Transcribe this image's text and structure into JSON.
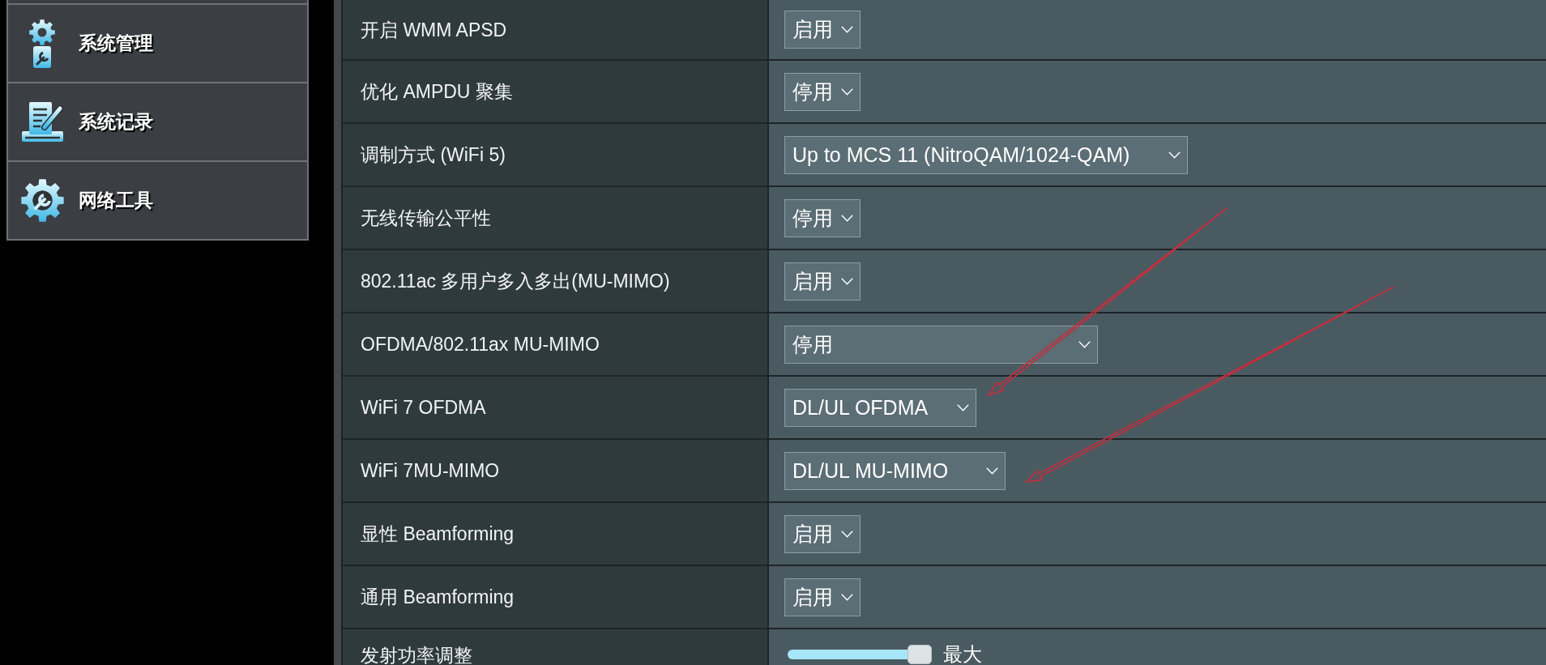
{
  "sidebar": {
    "items": [
      {
        "label": "系统管理",
        "selected": false
      },
      {
        "label": "系统记录",
        "selected": false
      },
      {
        "label": "网络工具",
        "selected": false
      }
    ]
  },
  "settings": {
    "rows": [
      {
        "kind": "select",
        "label": "开启 WMM APSD",
        "value": "启用"
      },
      {
        "kind": "select",
        "label": "优化 AMPDU 聚集",
        "value": "停用"
      },
      {
        "kind": "select",
        "label": "调制方式 (WiFi 5)",
        "value": "Up to MCS 11 (NitroQAM/1024-QAM)"
      },
      {
        "kind": "select",
        "label": "无线传输公平性",
        "value": "停用"
      },
      {
        "kind": "select",
        "label": "802.11ac 多用户多入多出(MU-MIMO)",
        "value": "启用"
      },
      {
        "kind": "select",
        "label": "OFDMA/802.11ax MU-MIMO",
        "value": "停用"
      },
      {
        "kind": "select",
        "label": "WiFi 7 OFDMA",
        "value": "DL/UL OFDMA"
      },
      {
        "kind": "select",
        "label": "WiFi 7MU-MIMO",
        "value": "DL/UL MU-MIMO"
      },
      {
        "kind": "select",
        "label": "显性 Beamforming",
        "value": "启用"
      },
      {
        "kind": "select",
        "label": "通用 Beamforming",
        "value": "启用"
      },
      {
        "kind": "slider",
        "label": "发射功率调整",
        "level": 1,
        "reading": "最大"
      }
    ]
  },
  "annotations": [
    {
      "kind": "arrow"
    },
    {
      "kind": "arrow"
    }
  ]
}
